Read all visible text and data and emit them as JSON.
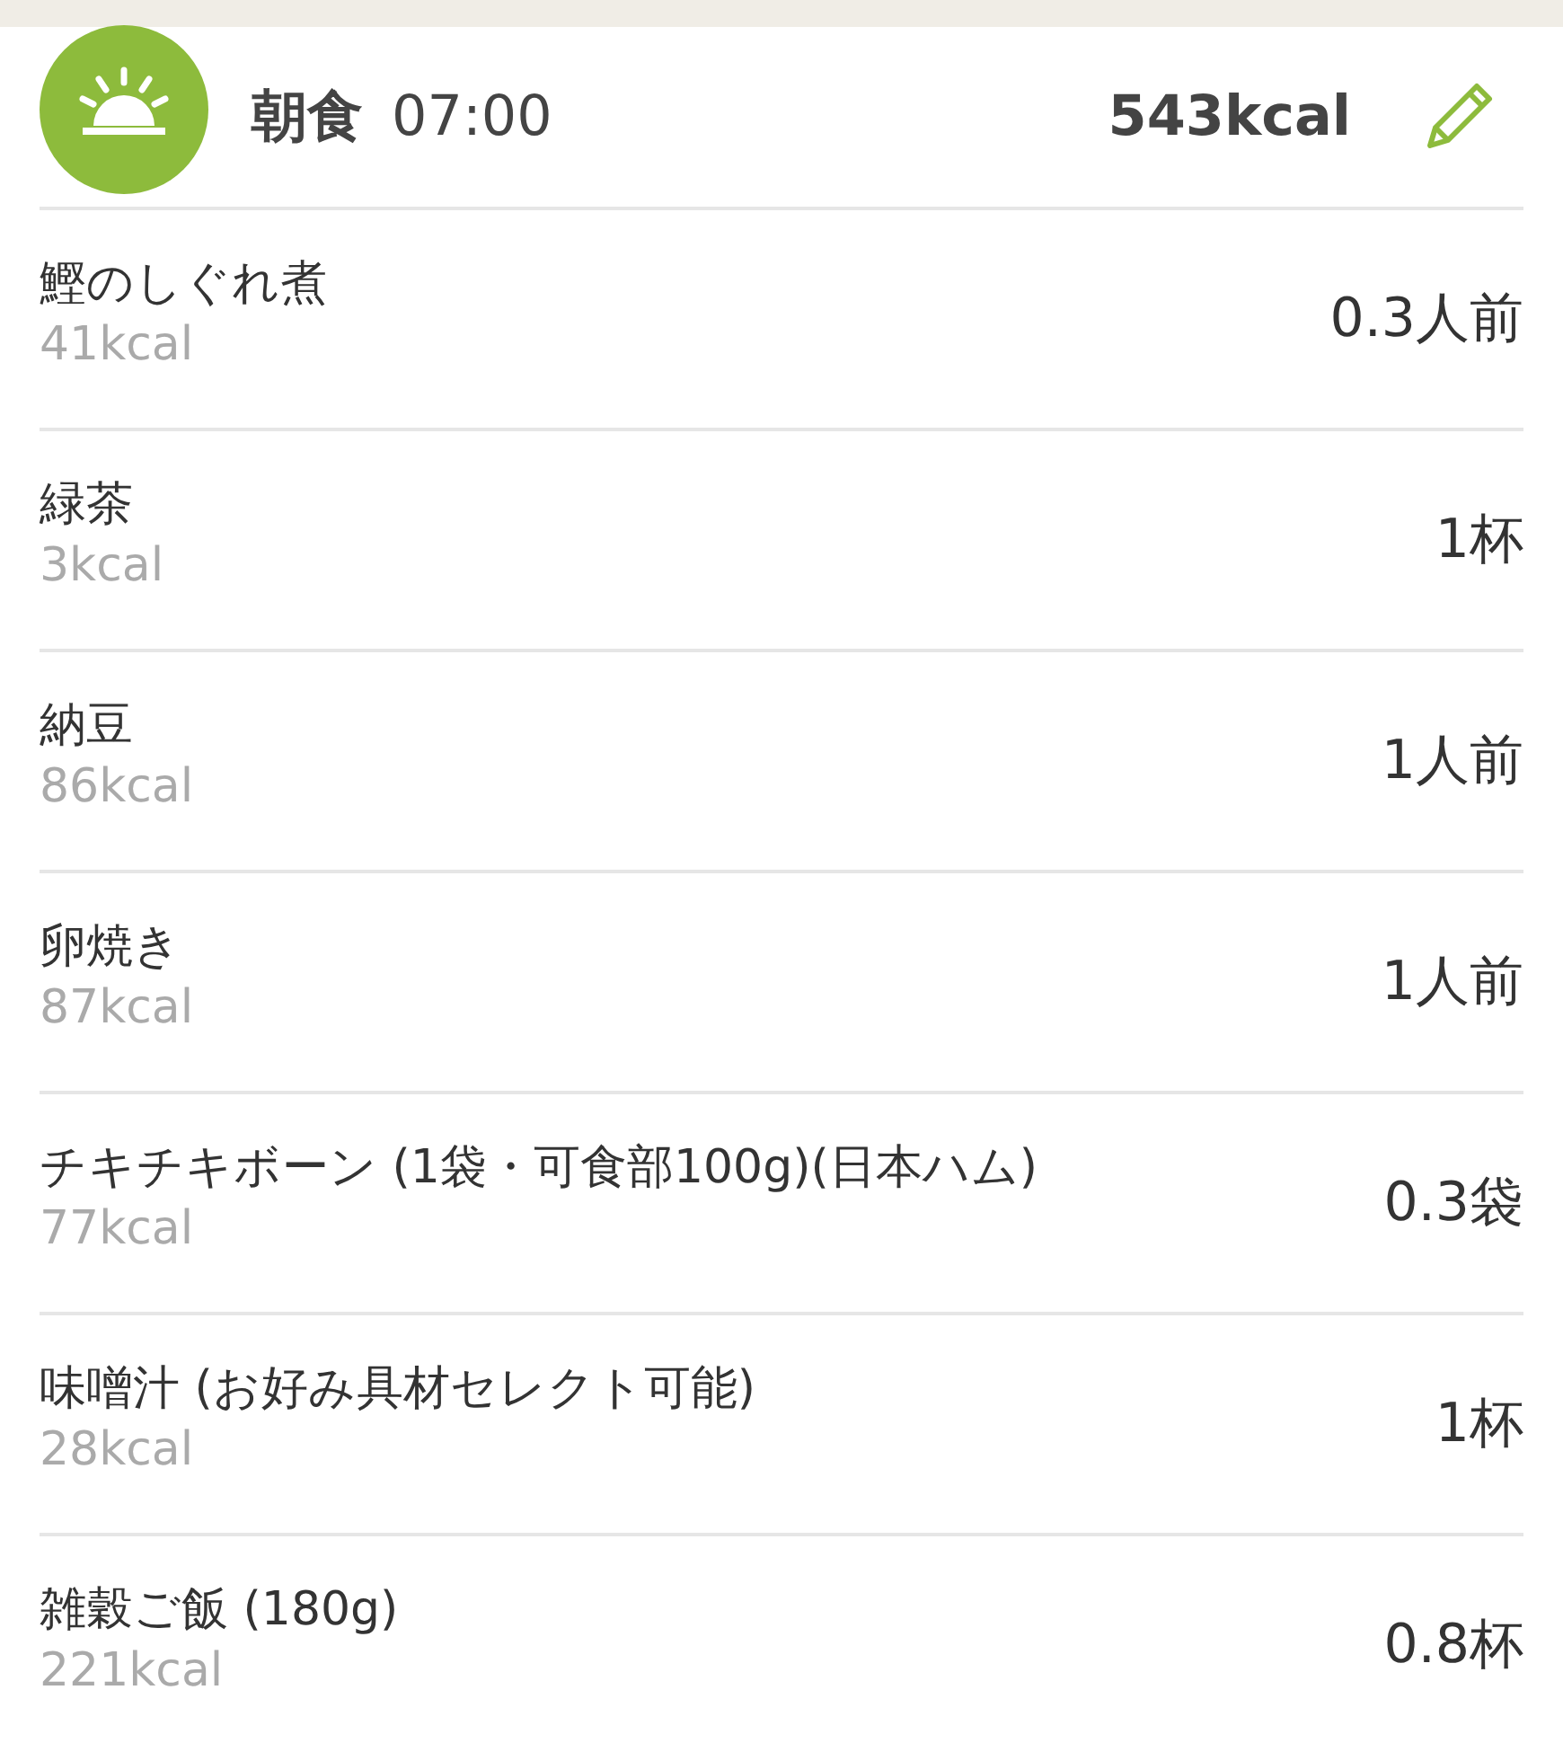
{
  "meal": {
    "name": "朝食",
    "time": "07:00",
    "total": "543kcal"
  },
  "items": [
    {
      "name": "鰹のしぐれ煮",
      "kcal": "41kcal",
      "amount": "0.3人前"
    },
    {
      "name": "緑茶",
      "kcal": "3kcal",
      "amount": "1杯"
    },
    {
      "name": "納豆",
      "kcal": "86kcal",
      "amount": "1人前"
    },
    {
      "name": "卵焼き",
      "kcal": "87kcal",
      "amount": "1人前"
    },
    {
      "name": "チキチキボーン (1袋・可食部100g)(日本ハム)",
      "kcal": "77kcal",
      "amount": "0.3袋"
    },
    {
      "name": "味噌汁 (お好み具材セレクト可能)",
      "kcal": "28kcal",
      "amount": "1杯"
    },
    {
      "name": "雑穀ご飯 (180g)",
      "kcal": "221kcal",
      "amount": "0.8杯"
    }
  ]
}
